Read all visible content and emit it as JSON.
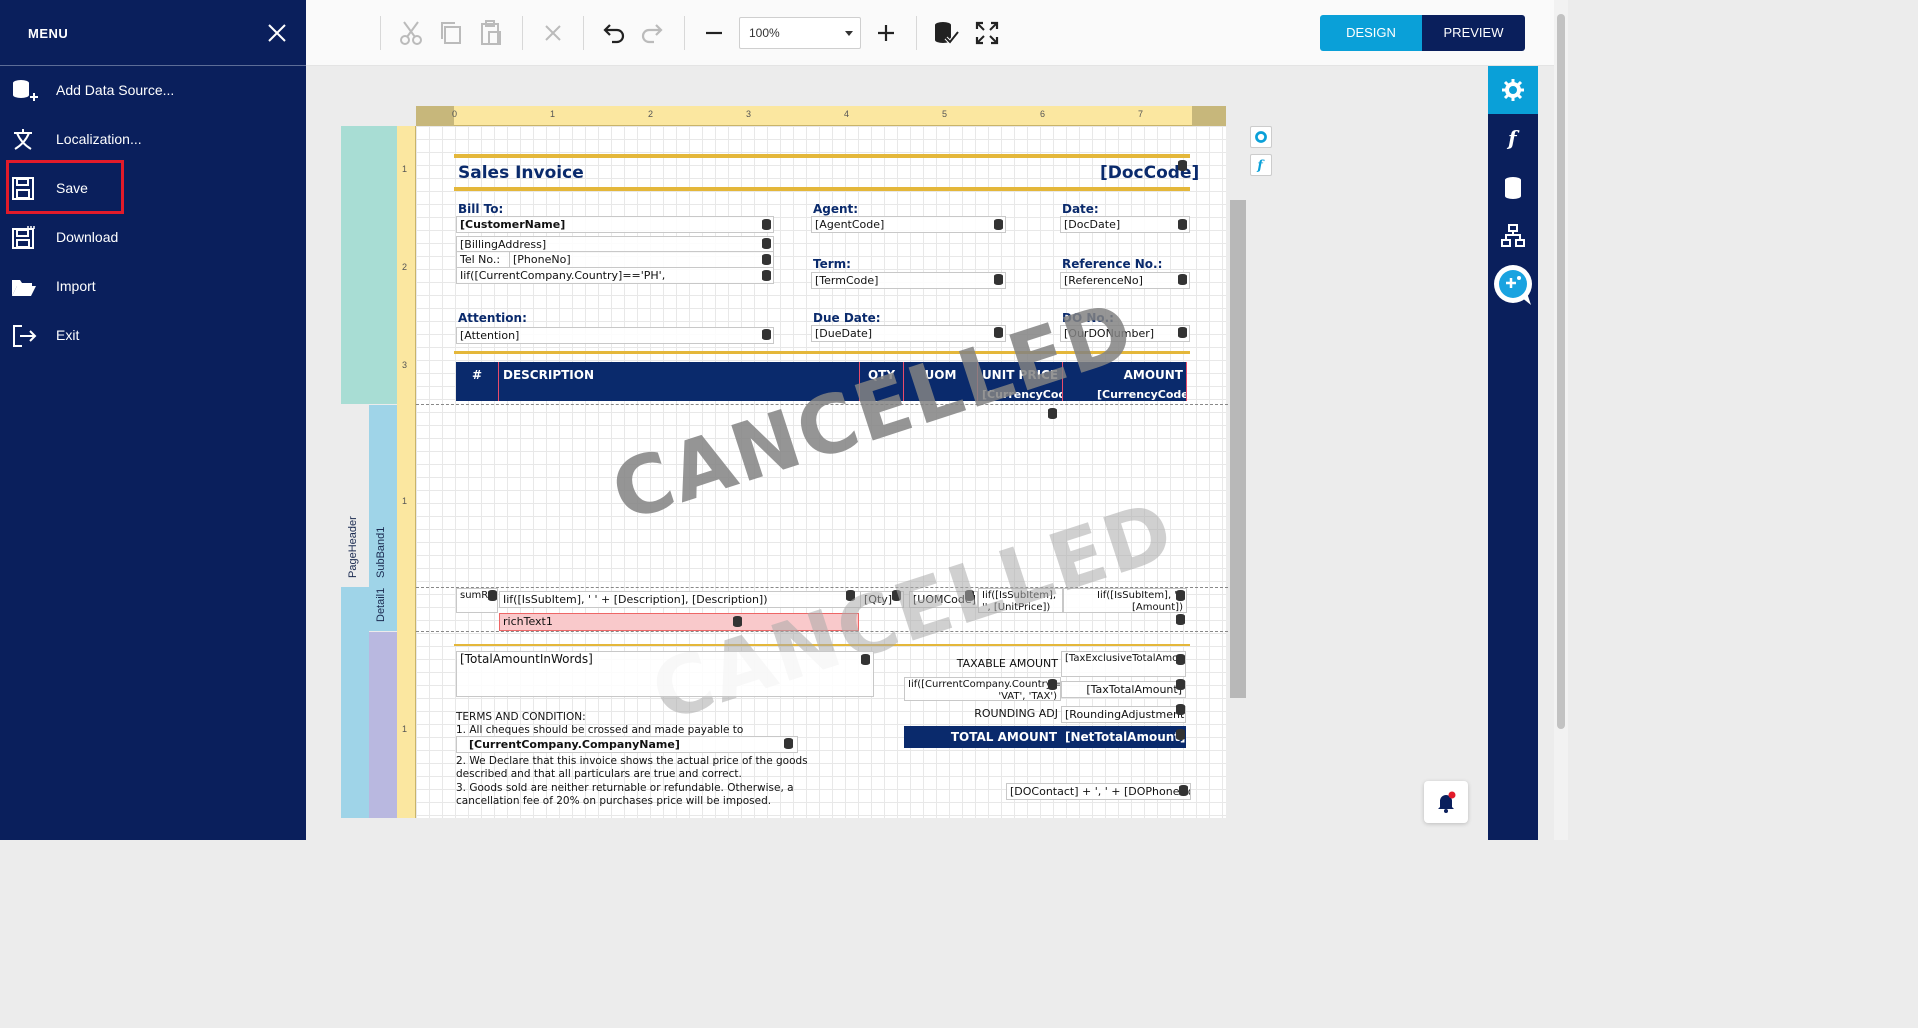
{
  "menu": {
    "title": "MENU",
    "items": [
      {
        "label": "Add Data Source...",
        "icon": "add-database-icon"
      },
      {
        "label": "Localization...",
        "icon": "translate-icon"
      },
      {
        "label": "Save",
        "icon": "save-icon"
      },
      {
        "label": "Download",
        "icon": "download-icon"
      },
      {
        "label": "Import",
        "icon": "folder-open-icon"
      },
      {
        "label": "Exit",
        "icon": "exit-icon"
      }
    ]
  },
  "toolbar": {
    "zoom": "100%",
    "design_label": "DESIGN",
    "preview_label": "PREVIEW"
  },
  "ruler": {
    "h_ticks": [
      "0",
      "1",
      "2",
      "3",
      "4",
      "5",
      "6",
      "7"
    ],
    "v_ticks": [
      "1",
      "2",
      "3",
      "1",
      "1"
    ]
  },
  "bands": {
    "page_header": "PageHeader",
    "sub_band": "SubBand1",
    "detail": "Detail1"
  },
  "report": {
    "title": "Sales Invoice",
    "doc_code": "[DocCode]",
    "bill_to_label": "Bill To:",
    "customer_name": "[CustomerName]",
    "billing_address": "[BillingAddress]",
    "tel_label": "Tel No.:",
    "phone_no": "[PhoneNo]",
    "country_expr": "Iif([CurrentCompany.Country]=='PH',",
    "agent_label": "Agent:",
    "agent_code": "[AgentCode]",
    "date_label": "Date:",
    "doc_date": "[DocDate]",
    "term_label": "Term:",
    "term_code": "[TermCode]",
    "reference_label": "Reference No.:",
    "reference_no": "[ReferenceNo]",
    "attention_label": "Attention:",
    "attention": "[Attention]",
    "due_date_label": "Due Date:",
    "due_date": "[DueDate]",
    "do_label": "DO No.:",
    "do_number": "[OurDONumber]",
    "columns": {
      "num": "#",
      "description": "DESCRIPTION",
      "qty": "QTY",
      "uom": "UOM",
      "unit_price": "UNIT PRICE",
      "amount": "AMOUNT"
    },
    "currency_code_1": "[CurrencyCode]",
    "currency_code_2": "[CurrencyCode]",
    "watermark": "CANCELLED",
    "detail_num": "sumRecordNumber",
    "detail_desc": "Iif([IsSubItem], '   ' + [Description], [Description])",
    "detail_qty": "[Qty]",
    "detail_uom": "[UOMCode]",
    "detail_unit_price": "Iif([IsSubItem], '', [UnitPrice])",
    "detail_amount": "Iif([IsSubItem], '', [Amount])",
    "rich_text": "richText1",
    "total_in_words": "[TotalAmountInWords]",
    "taxable_label": "TAXABLE AMOUNT",
    "tax_exclusive": "[TaxExclusiveTotalAmount]",
    "vat_expr": "Iif([CurrentCompany.Country]=='PH', 'VAT', 'TAX')",
    "tax_total": "[TaxTotalAmount]",
    "rounding_label": "ROUNDING ADJ",
    "rounding": "[RoundingAdjustment]",
    "total_label": "TOTAL AMOUNT",
    "net_total": "[NetTotalAmount]",
    "terms_title": "TERMS AND CONDITION:",
    "term1": "1. All cheques should be crossed and made payable to",
    "company_name": "[CurrentCompany.CompanyName]",
    "term2a": "2. We Declare that this invoice shows the actual price of the goods",
    "term2b": "described and that all particulars are true and correct.",
    "term3a": "3. Goods sold are neither returnable or refundable. Otherwise, a",
    "term3b": "cancellation fee of 20% on purchases price will be imposed.",
    "do_contact": "[DOContact] + ', ' + [DOPhoneNo]"
  },
  "colors": {
    "sidebar": "#0a1f5c",
    "accent": "#0aa0d8",
    "highlight": "#e21b2a",
    "gold": "#e4b73a"
  }
}
